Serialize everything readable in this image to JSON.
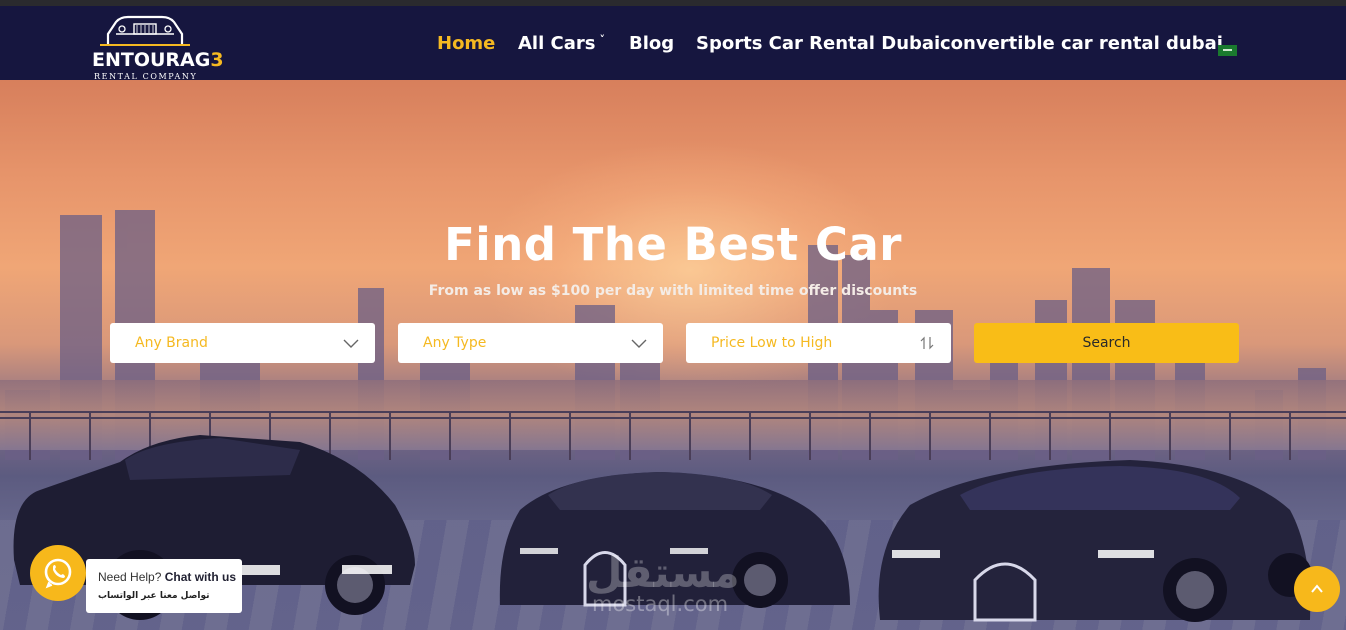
{
  "brand": {
    "logo_word_light": "ENTOURAG",
    "logo_word_gold": "3",
    "logo_tagline": "RENTAL COMPANY"
  },
  "nav": {
    "items": [
      {
        "label": "Home"
      },
      {
        "label": "All Cars"
      },
      {
        "label": "Blog"
      },
      {
        "label": "Sports Car Rental Dubai"
      },
      {
        "label": "convertible car rental dubai"
      }
    ],
    "all_cars_caret": "˅"
  },
  "hero": {
    "title": "Find The Best Car",
    "subtitle": "From as low as $100 per day with limited time offer discounts"
  },
  "filters": {
    "brand": "Any Brand",
    "type": "Any Type",
    "sort": "Price Low to High",
    "search_label": "Search"
  },
  "whatsapp": {
    "prefix": "Need Help? ",
    "chat_label": "Chat with us",
    "arabic_line": "تواصل معنا عبر الواتساب"
  },
  "watermark": {
    "arabic": "مستقل",
    "latin": "mostaql.com"
  },
  "colors": {
    "accent": "#f5b921",
    "navbar": "#16163f",
    "button": "#f9bd17"
  },
  "icons": [
    "car-logo-icon",
    "flag-icon",
    "chevron-down-icon",
    "sort-arrows-icon",
    "whatsapp-icon",
    "chevron-up-icon"
  ]
}
